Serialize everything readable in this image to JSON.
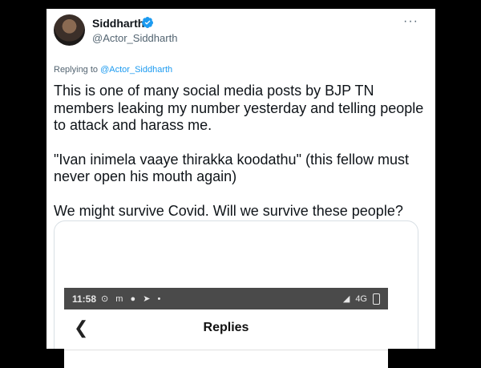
{
  "tweet": {
    "author_name": "Siddharth",
    "author_handle": "@Actor_Siddharth",
    "replying_label": "Replying to",
    "replying_to": "@Actor_Siddharth",
    "paragraphs": [
      "This is one of many social media posts by BJP TN members leaking my number yesterday and telling people to attack and harass me.",
      "\"Ivan inimela vaaye thirakka koodathu\" (this fellow must never open his mouth again)",
      "We might survive Covid. Will we survive these people?"
    ],
    "more_icon": "more-icon"
  },
  "embedded_screenshot": {
    "status_time": "11:58",
    "status_icons": "⊙ m ● ➤ •",
    "network_label": "4G",
    "screen_title": "Replies",
    "back_icon": "back-arrow-icon"
  },
  "colors": {
    "verified_blue": "#1d9bf0",
    "text_primary": "#0f1419",
    "text_secondary": "#536471",
    "status_bar_bg": "#4a4a4a"
  }
}
